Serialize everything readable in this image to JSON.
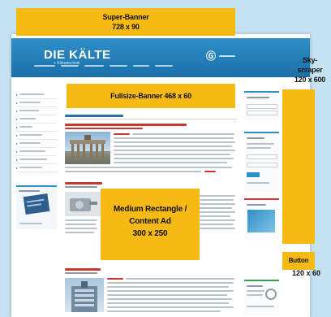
{
  "ad_formats": {
    "super_banner": {
      "name": "Super-Banner",
      "size": "728 x 90"
    },
    "fullsize_banner": {
      "label": "Fullsize-Banner 468 x 60"
    },
    "medium_rectangle": {
      "line1": "Medium Rectangle /",
      "line2": "Content Ad",
      "size": "300 x 250"
    },
    "skyscraper": {
      "line1": "Sky-",
      "line2": "scraper",
      "size": "120 x 600"
    },
    "button": {
      "name": "Button",
      "size": "120 x 60"
    }
  },
  "site": {
    "logo": "DIE KÄLTE",
    "logo_sub": "+ Klimatechnik"
  },
  "colors": {
    "ad_fill": "#f7b913",
    "header_blue": "#1b6fa8",
    "page_background": "#c5e2f2",
    "headline_red": "#c0392b"
  }
}
